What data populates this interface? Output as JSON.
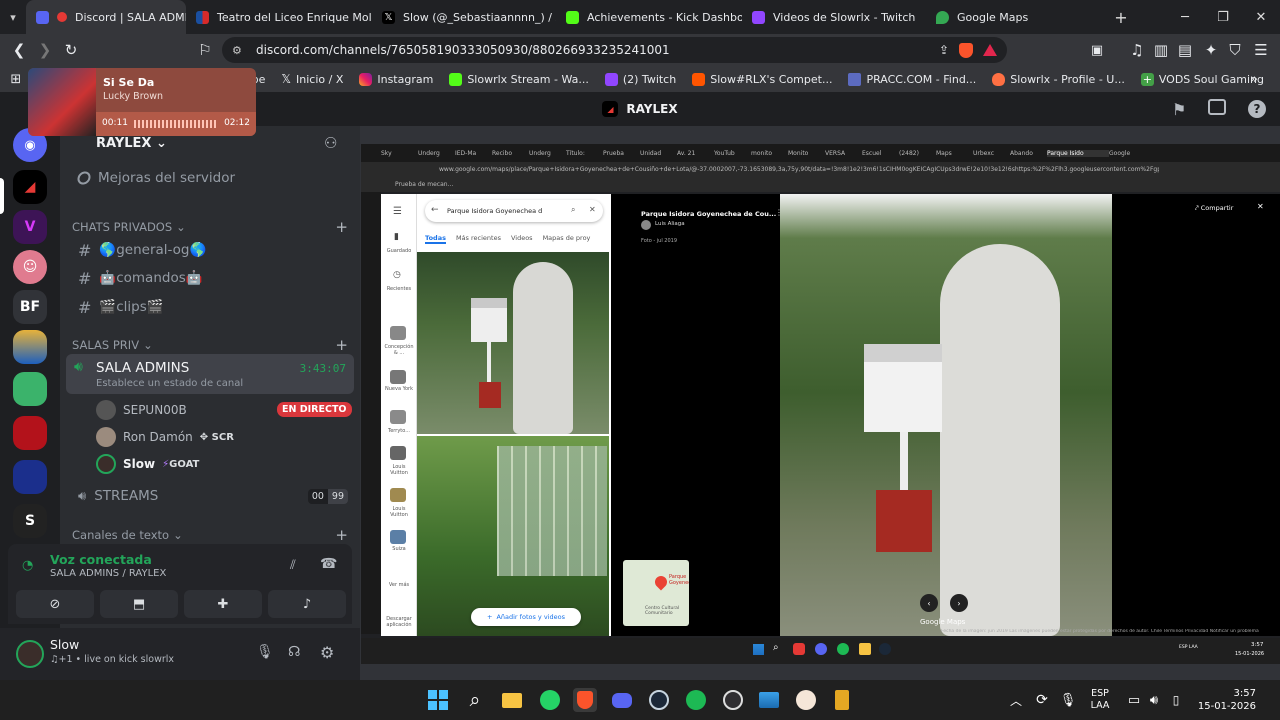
{
  "browser": {
    "tabs": [
      {
        "label": "Discord | SALA ADMINS",
        "color": "#5865f2",
        "active": true
      },
      {
        "label": "Teatro del Liceo Enrique Molina",
        "color": "#1a73e8"
      },
      {
        "label": "Slow (@_Sebastiaannnn_) / X",
        "color": "#000000"
      },
      {
        "label": "Achievements - Kick Dashboard",
        "color": "#53fc18"
      },
      {
        "label": "Videos de Slowrlx - Twitch",
        "color": "#9146ff"
      },
      {
        "label": "Google Maps",
        "color": "#34a853"
      }
    ],
    "url": "discord.com/channels/765058190333050930/880266933235241001",
    "bookmarks": [
      {
        "label": "be",
        "icon": "youtube-icon"
      },
      {
        "label": "Inicio / X",
        "icon": "x-icon"
      },
      {
        "label": "Instagram",
        "icon": "instagram-icon"
      },
      {
        "label": "Slowrlx Stream - Wa...",
        "icon": "kick-icon"
      },
      {
        "label": "(2) Twitch",
        "icon": "twitch-icon"
      },
      {
        "label": "Slow#RLX's Compet...",
        "icon": "faceit-icon"
      },
      {
        "label": "PRACC.COM - Find...",
        "icon": "pracc-icon"
      },
      {
        "label": "Slowrlx - Profile - U...",
        "icon": "fire-icon"
      },
      {
        "label": "VODS Soul Gaming",
        "icon": "plus-icon"
      }
    ]
  },
  "music": {
    "title": "Si Se Da",
    "artist": "Lucky Brown",
    "elapsed": "00:11",
    "total": "02:12"
  },
  "discord": {
    "server_title": "RAYLEX",
    "server_name": "RAYLEX",
    "boost": "Mejoras del servidor",
    "categories": {
      "private_chats": "CHATS PRIVADOS",
      "private_rooms": "SALAS PRIV",
      "text_channels": "Canales de texto"
    },
    "channels": [
      "🌎general-og🌎",
      "🤖comandos🤖",
      "🎬clips🎬"
    ],
    "voice_channel": {
      "name": "SALA ADMINS",
      "timer": "3:43:07",
      "status": "Establece un estado de canal"
    },
    "members": [
      {
        "name": "SEPUN00B",
        "badge": "EN DIRECTO"
      },
      {
        "name": "Ron Damón",
        "tag": "SCR"
      },
      {
        "name": "Slow",
        "tag": "GOAT"
      }
    ],
    "streams_channel": {
      "name": "STREAMS",
      "count_a": "00",
      "count_b": "99"
    },
    "voice_status": {
      "title": "Voz conectada",
      "subtitle": "SALA ADMINS / RAYLEX"
    },
    "user": {
      "name": "Slow",
      "status": "♫+1 • live on kick slowrlx"
    }
  },
  "stream": {
    "tabs": [
      "Sky",
      "Underg",
      "IED-Ma",
      "Recibo",
      "Underg",
      "Título:",
      "Prueba",
      "Unidad",
      "Av. 21",
      "YouTub",
      "monito",
      "Monito",
      "VERSA",
      "Escuel",
      "(2482)",
      "Maps",
      "Urbexc",
      "Abando",
      "Parque Isido",
      "Google"
    ],
    "url": "www.google.com/maps/place/Parque+Isidora+Goyenechea+de+Cousiño+de+Lota/@-37.0002007,-73.1653089,3a,75y,90t/data=!3m8!1e2!3m6!1sCIHM0ogKEICAgICUps3drwE!2e10!3e12!6shttps:%2F%2Flh3.googleusercontent.com%2Fgps-c",
    "bookmark": "Prueba de mecan...",
    "search_value": "Parque Isidora Goyenechea d",
    "filters": [
      "Todas",
      "Más recientes",
      "Videos",
      "Mapas de proy"
    ],
    "side_items": [
      "Guardado",
      "Recientes",
      "Concepción & ...",
      "Nueva York",
      "Terryto...",
      "Louis Vuitton",
      "Louis Vuitton",
      "Suiza",
      "Ver más",
      "Descargar aplicación"
    ],
    "add_media": "Añadir fotos y videos",
    "place_title": "Parque Isidora Goyenechea de Cou...",
    "place_author": "Luis Aliaga",
    "place_date": "Foto - jul 2019",
    "share": "Compartir",
    "map_thumb": "Parque Goyenech",
    "map_thumb2": "Centro Cultural Comunitario",
    "watermark": "Google Maps",
    "footer": "Fecha de la imagen: jun 2019   Las imágenes pueden estar protegidas por derechos de autor.   Chile   Términos   Privacidad   Notificar un problema",
    "inner_time": "3:57",
    "inner_date": "15-01-2026",
    "inner_lang": "ESP LAA"
  },
  "taskbar": {
    "lang1": "ESP",
    "lang2": "LAA",
    "time": "3:57",
    "date": "15-01-2026"
  }
}
